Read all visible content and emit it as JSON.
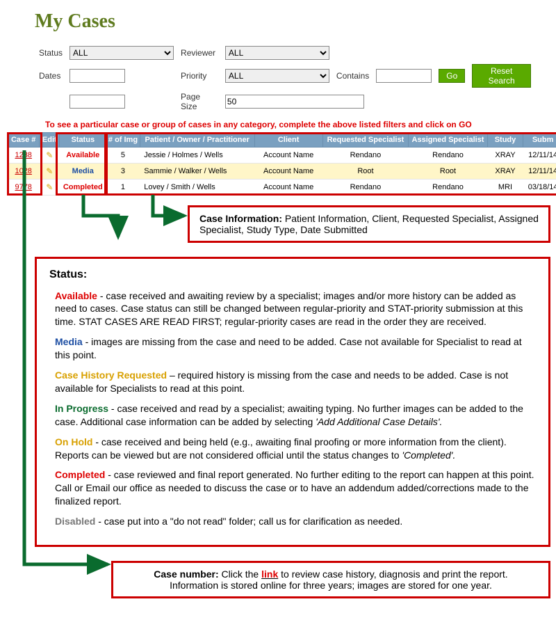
{
  "title": "My Cases",
  "filters": {
    "status_label": "Status",
    "status_value": "ALL",
    "reviewer_label": "Reviewer",
    "reviewer_value": "ALL",
    "dates_label": "Dates",
    "date_from": "",
    "date_to": "",
    "priority_label": "Priority",
    "priority_value": "ALL",
    "pagesize_label": "Page Size",
    "pagesize_value": "50",
    "contains_label": "Contains",
    "contains_value": "",
    "go_btn": "Go",
    "reset_btn": "Reset Search",
    "note": "To see a particular case or group of cases in any category, complete the above listed filters and click on GO"
  },
  "grid": {
    "headers": {
      "case": "Case #",
      "edit": "Edit",
      "status": "Status",
      "nimg": "# of Img",
      "pop": "Patient / Owner / Practitioner",
      "client": "Client",
      "reqspec": "Requested Specialist",
      "aspec": "Assigned Specialist",
      "study": "Study",
      "subm": "Subm"
    },
    "rows": [
      {
        "case": "1238",
        "status": "Available",
        "status_cls": "st-available",
        "nimg": "5",
        "pop": "Jessie / Holmes / Wells",
        "client": "Account Name",
        "req": "Rendano",
        "asg": "Rendano",
        "study": "XRAY",
        "subm": "12/11/14"
      },
      {
        "case": "1028",
        "status": "Media",
        "status_cls": "st-media",
        "nimg": "3",
        "pop": "Sammie / Walker / Wells",
        "client": "Account Name",
        "req": "Root",
        "asg": "Root",
        "study": "XRAY",
        "subm": "12/11/14"
      },
      {
        "case": "9778",
        "status": "Completed",
        "status_cls": "st-completed",
        "nimg": "1",
        "pop": "Lovey / Smith / Wells",
        "client": "Account Name",
        "req": "Rendano",
        "asg": "Rendano",
        "study": "MRI",
        "subm": "03/18/14"
      }
    ]
  },
  "caseinfo_callout": {
    "label": "Case Information:",
    "text": "Patient Information, Client, Requested Specialist, Assigned Specialist, Study Type, Date Submitted"
  },
  "status_section": {
    "heading": "Status:",
    "items": [
      {
        "label": "Available",
        "cls": "c-avail",
        "text": " - case received and awaiting review by a specialist; images and/or more history can be added as need to cases.  Case status can still be changed between regular-priority and STAT-priority submission at this time.  STAT CASES ARE READ FIRST; regular-priority cases are read in the order they are received."
      },
      {
        "label": "Media",
        "cls": "c-media",
        "text": " - images are missing from the case and need to be added. Case not available for Specialist to read at this point."
      },
      {
        "label": "Case History Requested",
        "cls": "c-chr",
        "text": " – required history is missing from the case and needs to be added. Case is not available for Specialists to read at this point."
      },
      {
        "label": "In Progress",
        "cls": "c-prog",
        "text": " - case received and read by a specialist; awaiting typing.  No further images can be added to the case.  Additional case information can be added by selecting ",
        "ital": "'Add Additional Case Details'."
      },
      {
        "label": "On Hold",
        "cls": "c-hold",
        "text": " - case received and being held (e.g., awaiting final proofing or more information from the client).  Reports can be viewed but are not considered official until the status changes to ",
        "ital": "'Completed'."
      },
      {
        "label": "Completed",
        "cls": "c-comp",
        "text": " - case reviewed and final report generated.  No further editing to the report can happen at this point. Call or Email our office as needed to discuss the case or to have an addendum added/corrections made to the finalized report."
      },
      {
        "label": "Disabled",
        "cls": "c-dis",
        "text": " - case put into a \"do not read\" folder; call us for clarification as needed."
      }
    ]
  },
  "casenum_callout": {
    "label": "Case number:",
    "pre": " Click the ",
    "link": "link",
    "post": " to review case history, diagnosis and print the report.",
    "line2": "Information is stored online for three years; images are stored for one year."
  }
}
